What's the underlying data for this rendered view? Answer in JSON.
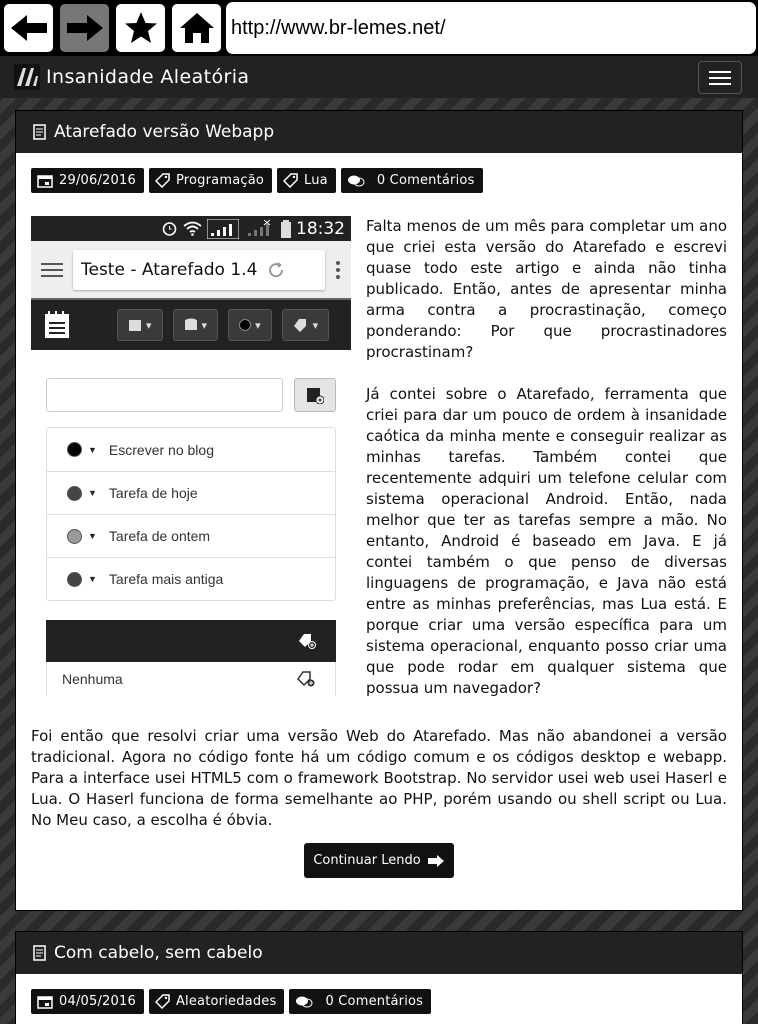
{
  "browser": {
    "url": "http://www.br-lemes.net/"
  },
  "site": {
    "title": "Insanidade Aleatória"
  },
  "posts": [
    {
      "title": "Atarefado versão Webapp",
      "date": "29/06/2016",
      "tags": [
        "Programação",
        "Lua"
      ],
      "comments": "0 Comentários",
      "paragraph1": "Falta menos de um mês para completar um ano que criei esta versão do Atarefado e escrevi quase todo este artigo e ainda não tinha publicado. Então, antes de apresentar minha arma contra a procrastinação, começo ponderando: Por que procrastinadores procrastinam?",
      "paragraph2": "Já contei sobre o Atarefado, ferramenta que criei para dar um pouco de ordem à insanidade caótica da minha mente e conseguir realizar as minhas tarefas. Também contei que recentemente adquiri um telefone celular com sistema operacional Android. Então, nada melhor que ter as tarefas sempre a mão. No entanto, Android é baseado em Java. E já contei também o que penso de diversas linguagens de programação, e Java não está entre as minhas preferências, mas Lua está. E porque criar uma versão específica para um sistema operacional, enquanto posso criar uma que pode rodar em qualquer sistema que possua um navegador?",
      "paragraph3": "Foi então que resolvi criar uma versão Web do Atarefado. Mas não abandonei a versão tradicional. Agora no código fonte há um código comum e os códigos desktop e webapp. Para a interface usei HTML5 com o framework Bootstrap. No servidor usei web usei Haserl e Lua. O Haserl funciona de forma semelhante ao PHP, porém usando ou shell script ou Lua. No Meu caso, a escolha é óbvia.",
      "read_more": "Continuar Lendo",
      "phone": {
        "clock": "18:32",
        "tab_title": "Teste - Atarefado 1.4",
        "tasks": [
          {
            "label": "Escrever no blog",
            "color": "#000000"
          },
          {
            "label": "Tarefa de hoje",
            "color": "#444444"
          },
          {
            "label": "Tarefa de ontem",
            "color": "#999999"
          },
          {
            "label": "Tarefa mais antiga",
            "color": "#444444"
          }
        ],
        "tag_row": "Nenhuma"
      }
    },
    {
      "title": "Com cabelo, sem cabelo",
      "date": "04/05/2016",
      "tags": [
        "Aleatoriedades"
      ],
      "comments": "0 Comentários"
    }
  ]
}
